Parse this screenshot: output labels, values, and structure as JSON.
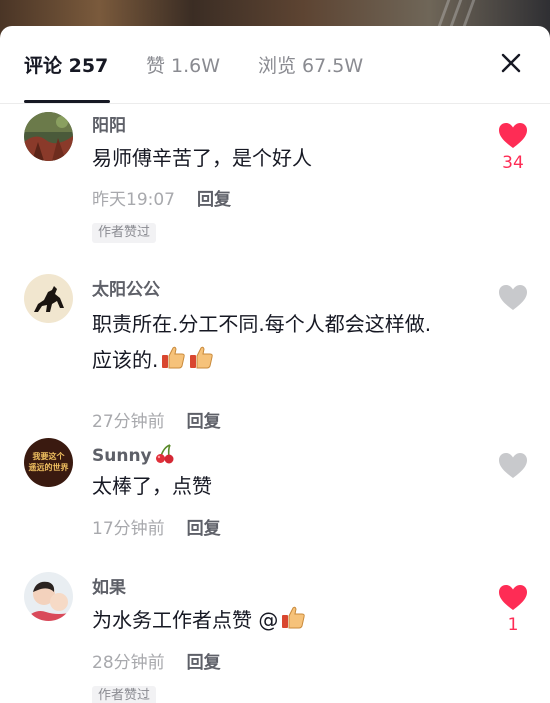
{
  "tabs": {
    "comments": "评论 257",
    "likes": "赞 1.6W",
    "views": "浏览 67.5W"
  },
  "comments": [
    {
      "username": "阳阳",
      "text": "易师傅辛苦了，是个好人",
      "time": "昨天19:07",
      "reply_label": "回复",
      "badge": "作者赞过",
      "liked": true,
      "like_count": "34"
    },
    {
      "username": "太阳公公",
      "text_line1": "职责所在.分工不同.每个人都会这样做.",
      "text_line2": "应该的.",
      "time": "27分钟前",
      "reply_label": "回复",
      "liked": false
    },
    {
      "username": "Sunny",
      "text": "太棒了，点赞",
      "time": "17分钟前",
      "reply_label": "回复",
      "liked": false,
      "avatar_text_line1": "我要这个",
      "avatar_text_line2": "遥远的世界"
    },
    {
      "username": "如果",
      "text": "为水务工作者点赞 @",
      "time": "28分钟前",
      "reply_label": "回复",
      "badge": "作者赞过",
      "liked": true,
      "like_count": "1"
    }
  ],
  "colors": {
    "like_red": "#fe2c55",
    "like_grey": "#c8c9cc",
    "text_primary": "#161823",
    "text_secondary": "#a8a9ad"
  },
  "icons": {
    "close": "close-icon",
    "heart": "heart-icon",
    "thumbs_up": "thumbs-up-emoji",
    "cherry": "cherry-emoji"
  }
}
